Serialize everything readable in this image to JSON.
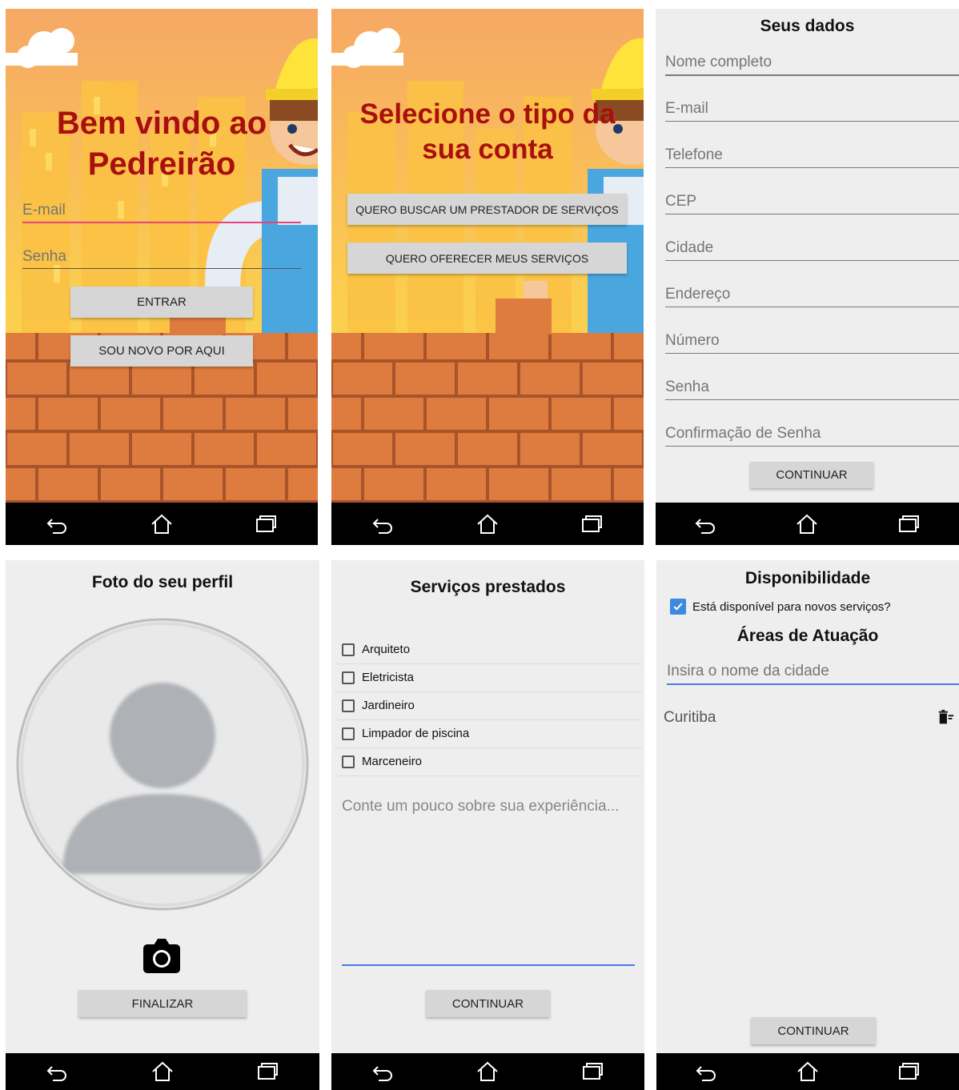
{
  "nav": {
    "back_icon": "back-arrow-icon",
    "home_icon": "home-icon",
    "recents_icon": "recents-icon"
  },
  "login": {
    "title_line1": "Bem vindo ao",
    "title_line2": "Pedreirão",
    "email_placeholder": "E-mail",
    "password_placeholder": "Senha",
    "enter_button": "ENTRAR",
    "new_user_button": "SOU NOVO POR AQUI"
  },
  "account_type": {
    "title_line1": "Selecione o tipo da",
    "title_line2": "sua conta",
    "search_provider_button": "QUERO BUSCAR UM PRESTADOR DE SERVIÇOS",
    "offer_services_button": "QUERO OFERECER MEUS SERVIÇOS"
  },
  "your_data": {
    "title": "Seus dados",
    "fields": {
      "full_name": "Nome completo",
      "email": "E-mail",
      "phone": "Telefone",
      "cep": "CEP",
      "city": "Cidade",
      "address": "Endereço",
      "number": "Número",
      "password": "Senha",
      "password_confirm": "Confirmação de Senha"
    },
    "continue_button": "CONTINUAR"
  },
  "profile_photo": {
    "title": "Foto do seu perfil",
    "camera_icon": "camera-icon",
    "finish_button": "FINALIZAR"
  },
  "services": {
    "title": "Serviços prestados",
    "options": [
      "Arquiteto",
      "Eletricista",
      "Jardineiro",
      "Limpador de piscina",
      "Marceneiro"
    ],
    "experience_placeholder": "Conte um pouco sobre sua experiência...",
    "continue_button": "CONTINUAR"
  },
  "availability": {
    "title": "Disponibilidade",
    "available_label": "Está disponível para novos serviços?",
    "available_checked": true,
    "areas_title": "Áreas de Atuação",
    "city_placeholder": "Insira o nome da cidade",
    "cities": [
      "Curitiba"
    ],
    "delete_icon": "delete-list-icon",
    "continue_button": "CONTINUAR"
  },
  "colors": {
    "title_red": "#a80f0f",
    "sky": "#f9b36a",
    "brick": "#db7a3f",
    "focus_pink": "#e8437a",
    "focus_blue": "#4a7be8",
    "checkbox_blue": "#3b8ae0"
  }
}
